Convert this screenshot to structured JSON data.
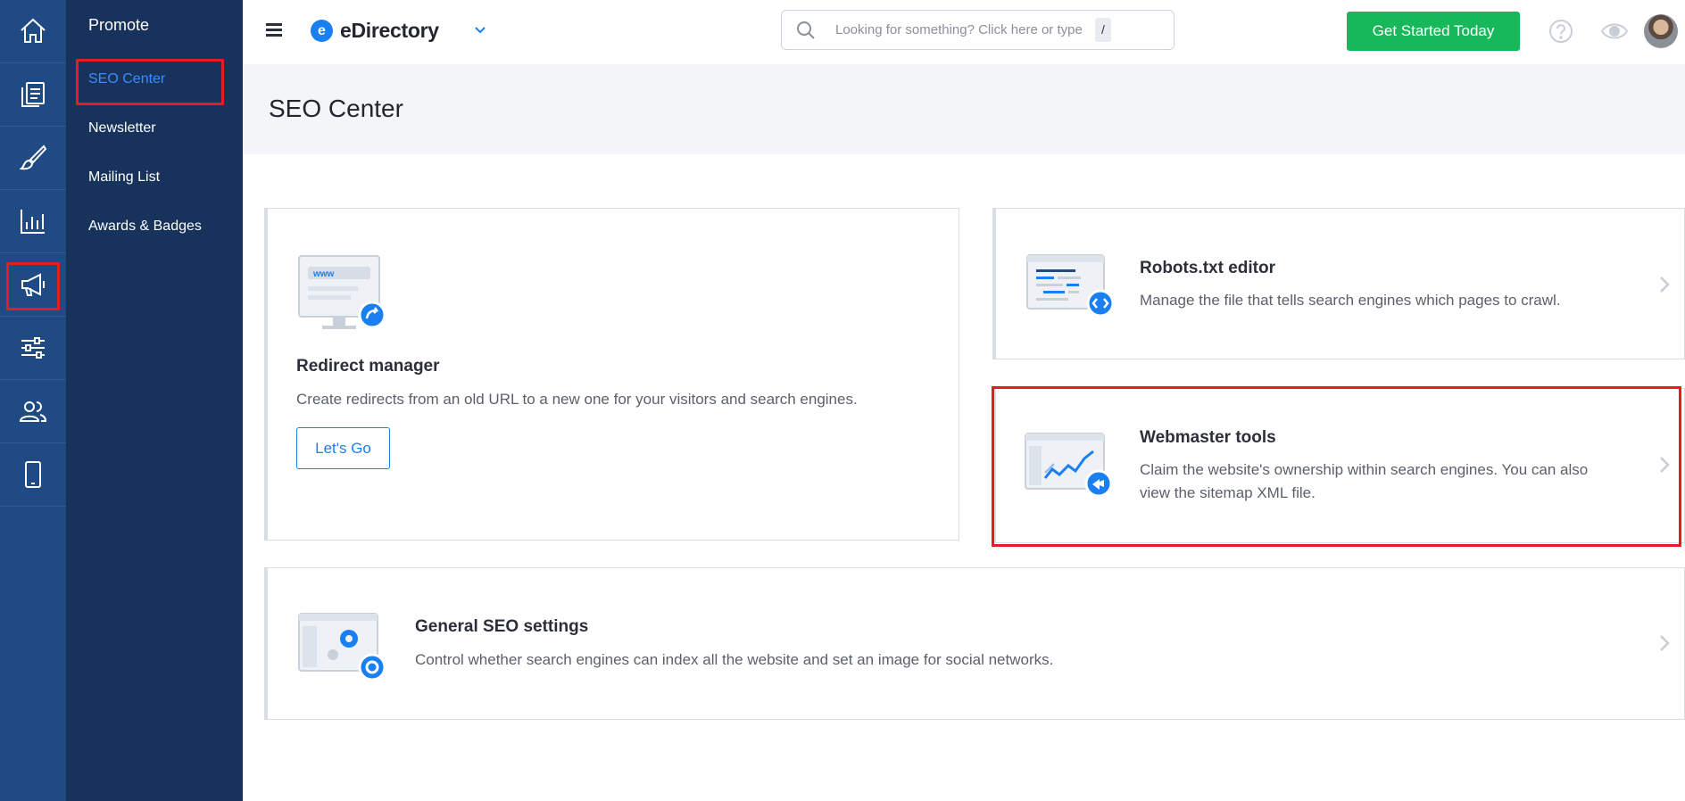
{
  "rail": {
    "items": [
      {
        "icon": "home-icon"
      },
      {
        "icon": "content-pages-icon"
      },
      {
        "icon": "design-brush-icon"
      },
      {
        "icon": "reports-chart-icon"
      },
      {
        "icon": "promote-megaphone-icon"
      },
      {
        "icon": "settings-sliders-icon"
      },
      {
        "icon": "users-icon"
      },
      {
        "icon": "mobile-icon"
      }
    ]
  },
  "subnav": {
    "title": "Promote",
    "items": [
      {
        "label": "SEO Center"
      },
      {
        "label": "Newsletter"
      },
      {
        "label": "Mailing List"
      },
      {
        "label": "Awards & Badges"
      }
    ]
  },
  "topbar": {
    "logo_mark": "e",
    "logo_text": "eDirectory",
    "search_placeholder": "Looking for something? Click here or type",
    "search_shortcut": "/",
    "cta_label": "Get Started Today"
  },
  "page": {
    "title": "SEO Center"
  },
  "cards": {
    "redirect": {
      "title": "Redirect manager",
      "desc": "Create redirects from an old URL to a new one for your visitors and search engines.",
      "button": "Let's Go",
      "illustration_text": "www"
    },
    "robots": {
      "title": "Robots.txt editor",
      "desc": "Manage the file that tells search engines which pages to crawl."
    },
    "webmaster": {
      "title": "Webmaster tools",
      "desc": "Claim the website's ownership within search engines. You can also view the sitemap XML file."
    },
    "general": {
      "title": "General SEO settings",
      "desc": "Control whether search engines can index all the website and set an image for social networks."
    }
  },
  "colors": {
    "rail_bg": "#1f4a84",
    "subnav_bg": "#17335c",
    "accent_blue": "#1a7ff0",
    "cta_green": "#17b85a",
    "highlight_red": "#e41c23"
  }
}
